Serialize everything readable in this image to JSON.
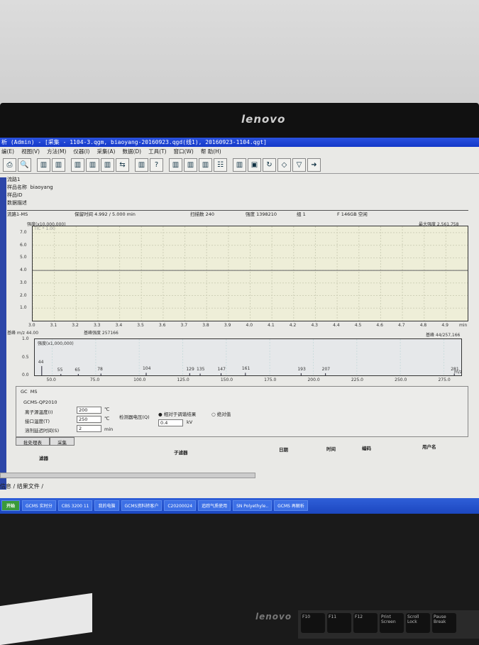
{
  "window": {
    "title": "析 (Admin) - [采集 - 1104-3.qgm, biaoyang-20160923.qgd(线1), 20160923-1104.qgt]"
  },
  "monitor": {
    "brand": "lenovo"
  },
  "menu": [
    "编(E)",
    "视图(V)",
    "方法(M)",
    "仪器(I)",
    "采集(A)",
    "数据(D)",
    "工具(T)",
    "窗口(W)",
    "帮 助(H)"
  ],
  "toolbar_icons": [
    "print-icon",
    "preview-icon",
    "chart-zoom-icon",
    "chart-zoom2-icon",
    "layout1-icon",
    "layout2-icon",
    "layout3-icon",
    "arrows-icon",
    "tune-icon",
    "help-icon",
    "spectrum1-icon",
    "spectrum2-icon",
    "spectrum3-icon",
    "table-icon",
    "spectrum4-icon",
    "frame-icon",
    "refresh-icon",
    "diamond-icon",
    "stop-icon",
    "arrow-right-icon"
  ],
  "info": {
    "flow": "流路1",
    "sample_name_label": "样品名称",
    "sample_name": "biaoyang",
    "sample_id_label": "样品ID",
    "data_desc_label": "数据描述"
  },
  "stats": {
    "channel": "流路1-MS",
    "retention": "保留时间 4.992 / 5.000 min",
    "scans": "扫描数 240",
    "intensity": "强度 1398210",
    "group": "组 1",
    "disk": "F 146GB 空闲"
  },
  "tic": {
    "ylabel": "强度(x10,000,000)",
    "trace": "TIC * 1.00",
    "max_label": "最大强度 2,561,758"
  },
  "ms_header": {
    "base_peak": "基峰 m/z 44.00",
    "base_intensity": "基峰强度 257166",
    "right": "基峰 44/257,166"
  },
  "chart_data": [
    {
      "type": "line",
      "title": "TIC",
      "ylabel": "强度(x10,000,000)",
      "xlabel": "min",
      "xlim": [
        3.0,
        5.0
      ],
      "ylim": [
        0,
        7.5
      ],
      "xticks": [
        "3.0",
        "3.1",
        "3.2",
        "3.3",
        "3.4",
        "3.5",
        "3.6",
        "3.7",
        "3.8",
        "3.9",
        "4.0",
        "4.1",
        "4.2",
        "4.3",
        "4.4",
        "4.5",
        "4.6",
        "4.7",
        "4.8",
        "4.9"
      ],
      "yticks": [
        "1.0",
        "2.0",
        "3.0",
        "4.0",
        "5.0",
        "6.0",
        "7.0"
      ],
      "x": [
        3.0,
        5.0
      ],
      "y": [
        4.0,
        4.0
      ]
    },
    {
      "type": "bar",
      "title": "MS",
      "ylabel": "强度(x1,000,000)",
      "xlabel": "m/z",
      "xlim": [
        40,
        285
      ],
      "ylim": [
        0,
        1.0
      ],
      "xticks": [
        "50.0",
        "75.0",
        "100.0",
        "125.0",
        "150.0",
        "175.0",
        "200.0",
        "225.0",
        "250.0",
        "275.0"
      ],
      "yticks": [
        "0.0",
        "0.5",
        "1.0"
      ],
      "mz": [
        44,
        55,
        65,
        78,
        104,
        129,
        135,
        147,
        161,
        193,
        207,
        281
      ],
      "values": [
        0.257,
        0.04,
        0.04,
        0.05,
        0.07,
        0.06,
        0.05,
        0.06,
        0.07,
        0.06,
        0.06,
        0.05
      ]
    }
  ],
  "params": {
    "tab_gc": "GC",
    "tab_ms": "MS",
    "model": "GCMS-QP2010",
    "ion_temp_label": "离子源温度(I)",
    "ion_temp": "200",
    "interface_temp_label": "接口温度(T)",
    "interface_temp": "250",
    "unit_c": "℃",
    "solvent_delay_label": "溶剂延迟时间(S)",
    "solvent_delay": "2",
    "unit_min": "min",
    "detector_label": "检测器电压(Q)",
    "relative": "相对于调谐结果",
    "absolute": "绝对值",
    "voltage": "0.4",
    "unit_kv": "kV"
  },
  "bottom_tabs": [
    "批处理表",
    "采集"
  ],
  "table_headers": {
    "filter": "滤器",
    "sub": "子滤器",
    "date": "日期",
    "time": "时间",
    "code": "编码",
    "user": "用户名"
  },
  "output_tabs": [
    "信息",
    "结果文件"
  ],
  "taskbar": [
    "开始",
    "GCMS 实时分",
    "CBS 3200 11",
    "我的电脑",
    "GCMS资料转客户",
    "C20200024",
    "追踪气质使用",
    "SN Polyethyle..",
    "GCMS 再解析"
  ],
  "keys": [
    "F10",
    "F11",
    "F12",
    "Print Screen",
    "Scroll Lock",
    "Pause Break"
  ]
}
